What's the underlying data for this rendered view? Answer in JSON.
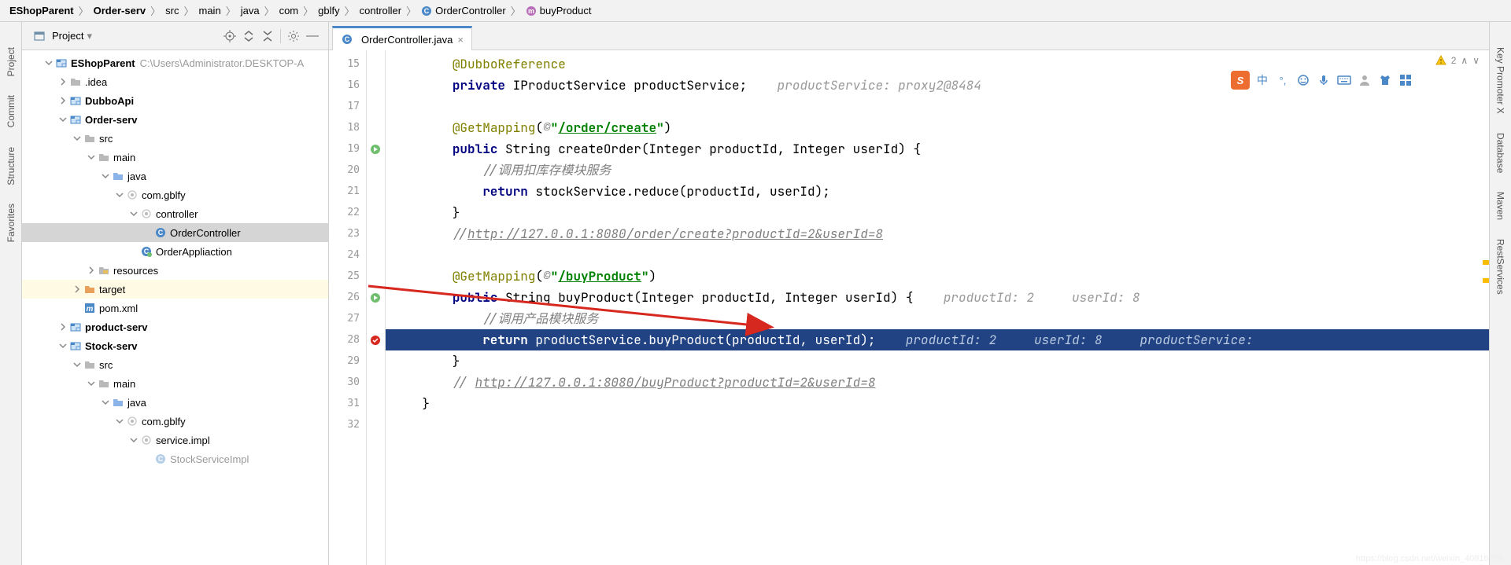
{
  "breadcrumb": [
    {
      "label": "EShopParent",
      "bold": true
    },
    {
      "label": "Order-serv",
      "bold": true
    },
    {
      "label": "src"
    },
    {
      "label": "main"
    },
    {
      "label": "java"
    },
    {
      "label": "com"
    },
    {
      "label": "gblfy"
    },
    {
      "label": "controller"
    },
    {
      "label": "OrderController",
      "icon": "class"
    },
    {
      "label": "buyProduct",
      "icon": "method"
    }
  ],
  "left_sidebar": [
    "Project",
    "Commit",
    "Structure",
    "Favorites"
  ],
  "right_sidebar": [
    "Key Promoter X",
    "Database",
    "Maven",
    "RestServices"
  ],
  "project": {
    "title": "Project",
    "root": {
      "name": "EShopParent",
      "path": "C:\\Users\\Administrator.DESKTOP-A"
    },
    "tree": [
      {
        "depth": 1,
        "arrow": "down",
        "icon": "module",
        "label": "EShopParent",
        "bold": true,
        "hint": "C:\\Users\\Administrator.DESKTOP-A"
      },
      {
        "depth": 2,
        "arrow": "right",
        "icon": "folder-gray",
        "label": ".idea"
      },
      {
        "depth": 2,
        "arrow": "right",
        "icon": "module",
        "label": "DubboApi",
        "bold": true
      },
      {
        "depth": 2,
        "arrow": "down",
        "icon": "module",
        "label": "Order-serv",
        "bold": true
      },
      {
        "depth": 3,
        "arrow": "down",
        "icon": "folder-gray",
        "label": "src"
      },
      {
        "depth": 4,
        "arrow": "down",
        "icon": "folder-gray",
        "label": "main"
      },
      {
        "depth": 5,
        "arrow": "down",
        "icon": "folder-blue",
        "label": "java"
      },
      {
        "depth": 6,
        "arrow": "down",
        "icon": "package",
        "label": "com.gblfy"
      },
      {
        "depth": 7,
        "arrow": "down",
        "icon": "package",
        "label": "controller"
      },
      {
        "depth": 8,
        "arrow": "",
        "icon": "class",
        "label": "OrderController",
        "selected": true
      },
      {
        "depth": 7,
        "arrow": "",
        "icon": "class-web",
        "label": "OrderAppliaction"
      },
      {
        "depth": 4,
        "arrow": "right",
        "icon": "folder-res",
        "label": "resources"
      },
      {
        "depth": 3,
        "arrow": "right",
        "icon": "folder-orange",
        "label": "target",
        "highlight": "yellow"
      },
      {
        "depth": 3,
        "arrow": "",
        "icon": "maven",
        "label": "pom.xml"
      },
      {
        "depth": 2,
        "arrow": "right",
        "icon": "module",
        "label": "product-serv",
        "bold": true
      },
      {
        "depth": 2,
        "arrow": "down",
        "icon": "module",
        "label": "Stock-serv",
        "bold": true
      },
      {
        "depth": 3,
        "arrow": "down",
        "icon": "folder-gray",
        "label": "src"
      },
      {
        "depth": 4,
        "arrow": "down",
        "icon": "folder-gray",
        "label": "main"
      },
      {
        "depth": 5,
        "arrow": "down",
        "icon": "folder-blue",
        "label": "java"
      },
      {
        "depth": 6,
        "arrow": "down",
        "icon": "package",
        "label": "com.gblfy"
      },
      {
        "depth": 7,
        "arrow": "down",
        "icon": "package",
        "label": "service.impl"
      },
      {
        "depth": 8,
        "arrow": "",
        "icon": "class",
        "label": "StockServiceImpl",
        "cut": true
      }
    ]
  },
  "editor": {
    "tab": {
      "label": "OrderController.java"
    },
    "status": {
      "warnings": "2"
    },
    "first_line_no": 15,
    "lines": [
      {
        "type": "code",
        "parts": [
          {
            "t": "        ",
            "c": ""
          },
          {
            "t": "@DubboReference",
            "c": "anno"
          }
        ]
      },
      {
        "type": "code",
        "parts": [
          {
            "t": "        ",
            "c": ""
          },
          {
            "t": "private",
            "c": "kw"
          },
          {
            "t": " IProductService ",
            "c": ""
          },
          {
            "t": "productService",
            "c": "ident"
          },
          {
            "t": ";    ",
            "c": ""
          },
          {
            "t": "productService: proxy2@8484",
            "c": "hint"
          }
        ]
      },
      {
        "type": "blank"
      },
      {
        "type": "code",
        "parts": [
          {
            "t": "        ",
            "c": ""
          },
          {
            "t": "@GetMapping",
            "c": "anno"
          },
          {
            "t": "(",
            "c": ""
          },
          {
            "t": "©",
            "c": "comment"
          },
          {
            "t": "\"",
            "c": "str-plain"
          },
          {
            "t": "/order/create",
            "c": "str"
          },
          {
            "t": "\"",
            "c": "str-plain"
          },
          {
            "t": ")",
            "c": ""
          }
        ]
      },
      {
        "type": "code",
        "marker": "run",
        "parts": [
          {
            "t": "        ",
            "c": ""
          },
          {
            "t": "public",
            "c": "kw"
          },
          {
            "t": " String createOrder(Integer productId, Integer userId) {",
            "c": ""
          }
        ]
      },
      {
        "type": "code",
        "parts": [
          {
            "t": "            ",
            "c": ""
          },
          {
            "t": "//调用扣库存模块服务",
            "c": "comment"
          }
        ]
      },
      {
        "type": "code",
        "parts": [
          {
            "t": "            ",
            "c": ""
          },
          {
            "t": "return",
            "c": "kw"
          },
          {
            "t": " ",
            "c": ""
          },
          {
            "t": "stockService",
            "c": "ident"
          },
          {
            "t": ".reduce(productId, userId);",
            "c": ""
          }
        ]
      },
      {
        "type": "code",
        "parts": [
          {
            "t": "        }",
            "c": ""
          }
        ]
      },
      {
        "type": "code",
        "parts": [
          {
            "t": "        ",
            "c": ""
          },
          {
            "t": "//",
            "c": "comment"
          },
          {
            "t": "http://127.0.0.1:8080/order/create?productId=2&userId=8",
            "c": "comment comment-link"
          }
        ]
      },
      {
        "type": "blank"
      },
      {
        "type": "code",
        "parts": [
          {
            "t": "        ",
            "c": ""
          },
          {
            "t": "@GetMapping",
            "c": "anno"
          },
          {
            "t": "(",
            "c": ""
          },
          {
            "t": "©",
            "c": "comment"
          },
          {
            "t": "\"",
            "c": "str-plain"
          },
          {
            "t": "/buyProduct",
            "c": "str"
          },
          {
            "t": "\"",
            "c": "str-plain"
          },
          {
            "t": ")",
            "c": ""
          }
        ]
      },
      {
        "type": "code",
        "marker": "run",
        "parts": [
          {
            "t": "        ",
            "c": ""
          },
          {
            "t": "public",
            "c": "kw"
          },
          {
            "t": " String buyProduct(Integer productId, Integer userId) {    ",
            "c": ""
          },
          {
            "t": "productId: 2     userId: 8",
            "c": "hint"
          }
        ]
      },
      {
        "type": "code",
        "parts": [
          {
            "t": "            ",
            "c": ""
          },
          {
            "t": "//调用产品模块服务",
            "c": "comment"
          }
        ]
      },
      {
        "type": "selected",
        "parts": [
          {
            "t": "            ",
            "c": ""
          },
          {
            "t": "return",
            "c": "kw"
          },
          {
            "t": " ",
            "c": ""
          },
          {
            "t": "productService",
            "c": ""
          },
          {
            "t": ".buyProduct(productId, userId);    ",
            "c": ""
          },
          {
            "t": "productId: 2     userId: 8     productService:",
            "c": "hint"
          }
        ],
        "marker": "breakpoint"
      },
      {
        "type": "code",
        "parts": [
          {
            "t": "        }",
            "c": ""
          }
        ]
      },
      {
        "type": "code",
        "parts": [
          {
            "t": "        ",
            "c": ""
          },
          {
            "t": "// ",
            "c": "comment"
          },
          {
            "t": "http://127.0.0.1:8080/buyProduct?productId=2&userId=8",
            "c": "comment comment-link"
          }
        ]
      },
      {
        "type": "code",
        "parts": [
          {
            "t": "    }",
            "c": ""
          }
        ]
      },
      {
        "type": "blank"
      }
    ]
  },
  "ime": {
    "lang": "中"
  },
  "watermark": "https://blog.csdn.net/weixin_40816738"
}
